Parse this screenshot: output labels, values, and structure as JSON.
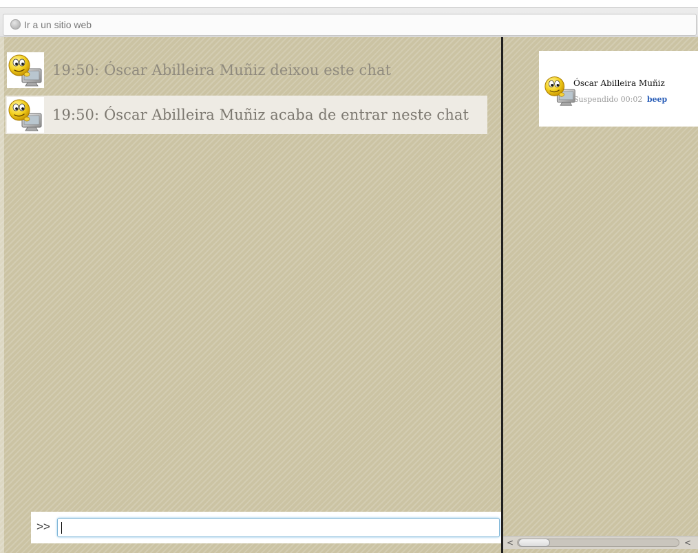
{
  "address_bar": {
    "placeholder": "Ir a un sitio web",
    "icon": "globe-icon"
  },
  "chat": {
    "messages": [
      {
        "text": "19:50: Óscar Abilleira Muñiz deixou este chat",
        "highlighted": false,
        "avatar": "smiley-computer-icon"
      },
      {
        "text": "19:50: Óscar Abilleira Muñiz acaba de entrar neste chat",
        "highlighted": true,
        "avatar": "smiley-computer-icon"
      }
    ],
    "input": {
      "prompt": ">>",
      "value": ""
    }
  },
  "users": [
    {
      "name": "Óscar Abilleira Muñiz",
      "status": "Suspendido 00:02",
      "action": "beep",
      "avatar": "smiley-computer-icon"
    }
  ],
  "scrollbar": {
    "left_arrow": "<",
    "right_arrow": "<"
  },
  "colors": {
    "background": "#cbc3a3",
    "highlight": "#eeebe4",
    "link": "#2a5eb8",
    "input_focus": "#7fb6d8"
  }
}
